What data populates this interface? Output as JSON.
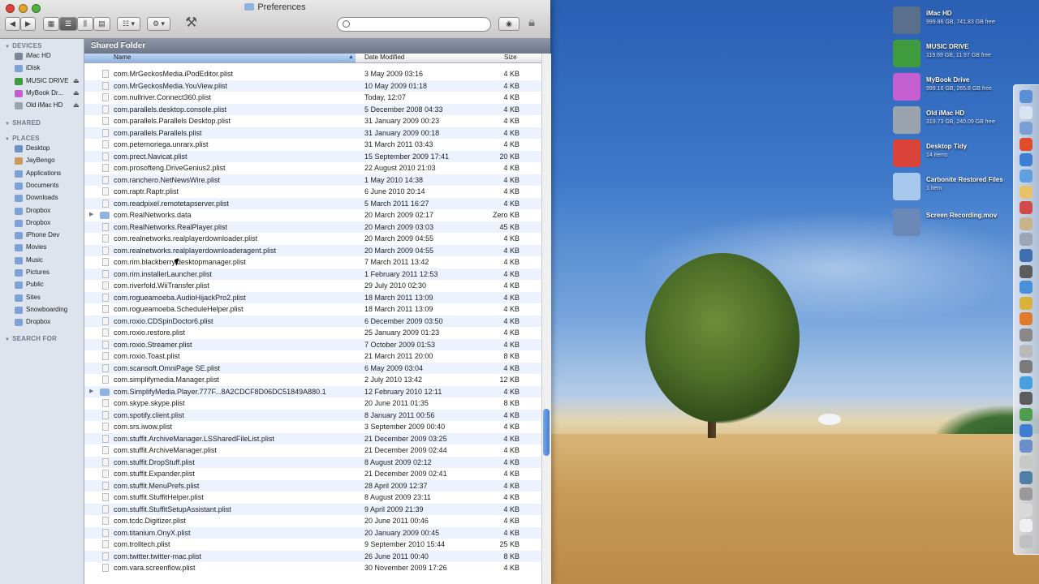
{
  "window": {
    "title": "Preferences",
    "path_title": "Shared Folder",
    "search_placeholder": ""
  },
  "toolbar": {
    "back": "◀",
    "forward": "▶",
    "view_icon": "view-icons-icon",
    "view_list": "view-list-icon",
    "view_columns": "view-columns-icon",
    "view_coverflow": "view-coverflow-icon",
    "arrange": "arrange-icon",
    "action": "gear-icon",
    "utility": "tools-icon",
    "quicklook": "eye-icon"
  },
  "sidebar": {
    "devices_header": "DEVICES",
    "devices": [
      {
        "label": "iMac HD",
        "eject": false,
        "color": "#7b8797"
      },
      {
        "label": "iDisk",
        "eject": false,
        "color": "#7ea1d6"
      },
      {
        "label": "MUSIC DRIVE",
        "eject": true,
        "color": "#3e9b3e"
      },
      {
        "label": "MyBook Dr...",
        "eject": true,
        "color": "#c55ed1"
      },
      {
        "label": "Old iMac HD",
        "eject": true,
        "color": "#9aa4ae"
      }
    ],
    "shared_header": "SHARED",
    "places_header": "PLACES",
    "places": [
      {
        "label": "Desktop",
        "color": "#6f8fc6"
      },
      {
        "label": "JayBengo",
        "color": "#c99b5c"
      },
      {
        "label": "Applications",
        "color": "#7ea1d6"
      },
      {
        "label": "Documents",
        "color": "#7ea1d6"
      },
      {
        "label": "Downloads",
        "color": "#7ea1d6"
      },
      {
        "label": "Dropbox",
        "color": "#7ea1d6"
      },
      {
        "label": "Dropbox",
        "color": "#7ea1d6"
      },
      {
        "label": "iPhone Dev",
        "color": "#7ea1d6"
      },
      {
        "label": "Movies",
        "color": "#7ea1d6"
      },
      {
        "label": "Music",
        "color": "#7ea1d6"
      },
      {
        "label": "Pictures",
        "color": "#7ea1d6"
      },
      {
        "label": "Public",
        "color": "#7ea1d6"
      },
      {
        "label": "Sites",
        "color": "#7ea1d6"
      },
      {
        "label": "Snowboarding",
        "color": "#7ea1d6"
      },
      {
        "label": "Dropbox",
        "color": "#7ea1d6"
      }
    ],
    "search_header": "SEARCH FOR"
  },
  "columns": {
    "name": "Name",
    "date": "Date Modified",
    "size": "Size"
  },
  "files": [
    {
      "name": "com.MrGeckosMedia.iPodEditor.plist",
      "date": "3 May 2009 03:16",
      "size": "4 KB",
      "folder": false
    },
    {
      "name": "com.MrGeckosMedia.YouView.plist",
      "date": "10 May 2009 01:18",
      "size": "4 KB",
      "folder": false
    },
    {
      "name": "com.nullriver.Connect360.plist",
      "date": "Today, 12:07",
      "size": "4 KB",
      "folder": false
    },
    {
      "name": "com.parallels.desktop.console.plist",
      "date": "5 December 2008 04:33",
      "size": "4 KB",
      "folder": false
    },
    {
      "name": "com.parallels.Parallels Desktop.plist",
      "date": "31 January 2009 00:23",
      "size": "4 KB",
      "folder": false
    },
    {
      "name": "com.parallels.Parallels.plist",
      "date": "31 January 2009 00:18",
      "size": "4 KB",
      "folder": false
    },
    {
      "name": "com.peternoriega.unrarx.plist",
      "date": "31 March 2011 03:43",
      "size": "4 KB",
      "folder": false
    },
    {
      "name": "com.prect.Navicat.plist",
      "date": "15 September 2009 17:41",
      "size": "20 KB",
      "folder": false
    },
    {
      "name": "com.prosofteng.DriveGenius2.plist",
      "date": "22 August 2010 21:03",
      "size": "4 KB",
      "folder": false
    },
    {
      "name": "com.ranchero.NetNewsWire.plist",
      "date": "1 May 2010 14:38",
      "size": "4 KB",
      "folder": false
    },
    {
      "name": "com.raptr.Raptr.plist",
      "date": "6 June 2010 20:14",
      "size": "4 KB",
      "folder": false
    },
    {
      "name": "com.readpixel.remotetapserver.plist",
      "date": "5 March 2011 16:27",
      "size": "4 KB",
      "folder": false
    },
    {
      "name": "com.RealNetworks.data",
      "date": "20 March 2009 02:17",
      "size": "Zero KB",
      "folder": true
    },
    {
      "name": "com.RealNetworks.RealPlayer.plist",
      "date": "20 March 2009 03:03",
      "size": "45 KB",
      "folder": false
    },
    {
      "name": "com.realnetworks.realplayerdownloader.plist",
      "date": "20 March 2009 04:55",
      "size": "4 KB",
      "folder": false
    },
    {
      "name": "com.realnetworks.realplayerdownloaderagent.plist",
      "date": "20 March 2009 04:55",
      "size": "4 KB",
      "folder": false
    },
    {
      "name": "com.rim.blackberry.desktopmanager.plist",
      "date": "7 March 2011 13:42",
      "size": "4 KB",
      "folder": false
    },
    {
      "name": "com.rim.installerLauncher.plist",
      "date": "1 February 2011 12:53",
      "size": "4 KB",
      "folder": false
    },
    {
      "name": "com.riverfold.WiiTransfer.plist",
      "date": "29 July 2010 02:30",
      "size": "4 KB",
      "folder": false
    },
    {
      "name": "com.rogueamoeba.AudioHijackPro2.plist",
      "date": "18 March 2011 13:09",
      "size": "4 KB",
      "folder": false
    },
    {
      "name": "com.rogueamoeba.ScheduleHelper.plist",
      "date": "18 March 2011 13:09",
      "size": "4 KB",
      "folder": false
    },
    {
      "name": "com.roxio.CDSpinDoctor6.plist",
      "date": "6 December 2009 03:50",
      "size": "4 KB",
      "folder": false
    },
    {
      "name": "com.roxio.restore.plist",
      "date": "25 January 2009 01:23",
      "size": "4 KB",
      "folder": false
    },
    {
      "name": "com.roxio.Streamer.plist",
      "date": "7 October 2009 01:53",
      "size": "4 KB",
      "folder": false
    },
    {
      "name": "com.roxio.Toast.plist",
      "date": "21 March 2011 20:00",
      "size": "8 KB",
      "folder": false
    },
    {
      "name": "com.scansoft.OmniPage SE.plist",
      "date": "6 May 2009 03:04",
      "size": "4 KB",
      "folder": false
    },
    {
      "name": "com.simplifymedia.Manager.plist",
      "date": "2 July 2010 13:42",
      "size": "12 KB",
      "folder": false
    },
    {
      "name": "com.SimplifyMedia.Player.777F...8A2CDCF8D06DC51849A880.1",
      "date": "12 February 2010 12:11",
      "size": "4 KB",
      "folder": true
    },
    {
      "name": "com.skype.skype.plist",
      "date": "20 June 2011 01:35",
      "size": "8 KB",
      "folder": false
    },
    {
      "name": "com.spotify.client.plist",
      "date": "8 January 2011 00:56",
      "size": "4 KB",
      "folder": false
    },
    {
      "name": "com.srs.iwow.plist",
      "date": "3 September 2009 00:40",
      "size": "4 KB",
      "folder": false
    },
    {
      "name": "com.stuffit.ArchiveManager.LSSharedFileList.plist",
      "date": "21 December 2009 03:25",
      "size": "4 KB",
      "folder": false
    },
    {
      "name": "com.stuffit.ArchiveManager.plist",
      "date": "21 December 2009 02:44",
      "size": "4 KB",
      "folder": false
    },
    {
      "name": "com.stuffit.DropStuff.plist",
      "date": "8 August 2009 02:12",
      "size": "4 KB",
      "folder": false
    },
    {
      "name": "com.stuffit.Expander.plist",
      "date": "21 December 2009 02:41",
      "size": "4 KB",
      "folder": false
    },
    {
      "name": "com.stuffit.MenuPrefs.plist",
      "date": "28 April 2009 12:37",
      "size": "4 KB",
      "folder": false
    },
    {
      "name": "com.stuffit.StuffitHelper.plist",
      "date": "8 August 2009 23:11",
      "size": "4 KB",
      "folder": false
    },
    {
      "name": "com.stuffit.StuffitSetupAssistant.plist",
      "date": "9 April 2009 21:39",
      "size": "4 KB",
      "folder": false
    },
    {
      "name": "com.tcdc.Digitizer.plist",
      "date": "20 June 2011 00:46",
      "size": "4 KB",
      "folder": false
    },
    {
      "name": "com.titanium.OnyX.plist",
      "date": "20 January 2009 00:45",
      "size": "4 KB",
      "folder": false
    },
    {
      "name": "com.trolltech.plist",
      "date": "9 September 2010 15:44",
      "size": "25 KB",
      "folder": false
    },
    {
      "name": "com.twitter.twitter-mac.plist",
      "date": "26 June 2011 00:40",
      "size": "8 KB",
      "folder": false
    },
    {
      "name": "com.vara.screenflow.plist",
      "date": "30 November 2009 17:26",
      "size": "4 KB",
      "folder": false
    }
  ],
  "desktop_items": [
    {
      "name": "iMac HD",
      "sub": "999.86 GB, 741.83 GB free",
      "icon": "imac-hd-icon",
      "color": "#5a6f8c"
    },
    {
      "name": "MUSIC DRIVE",
      "sub": "119.69 GB, 11.97 GB free",
      "icon": "music-drive-icon",
      "color": "#3e9b3e"
    },
    {
      "name": "MyBook Drive",
      "sub": "999.16 GB, 265.8 GB free",
      "icon": "mybook-drive-icon",
      "color": "#c55ed1"
    },
    {
      "name": "Old iMac HD",
      "sub": "319.73 GB, 240.09 GB free",
      "icon": "old-imac-hd-icon",
      "color": "#9aa4ae"
    },
    {
      "name": "Desktop Tidy",
      "sub": "14 items",
      "icon": "desktop-tidy-icon",
      "color": "#d9433a"
    },
    {
      "name": "Carbonite Restored Files",
      "sub": "1 item",
      "icon": "folder-icon",
      "color": "#a8c8ee"
    },
    {
      "name": "Screen Recording.mov",
      "sub": "",
      "icon": "movie-file-icon",
      "color": "#6a88b8"
    }
  ],
  "dock_colors": [
    "#5b8fd6",
    "#d8e2f0",
    "#7a9fd4",
    "#e04b2a",
    "#3a7fd5",
    "#5fa0e0",
    "#e6c36a",
    "#d24a4a",
    "#c8b48c",
    "#9ca6b5",
    "#3f6fb0",
    "#5c5c5c",
    "#4a8fd8",
    "#d9b13c",
    "#e07a2a",
    "#888",
    "#b9b9b9",
    "#7a7a7a",
    "#46a0e0",
    "#5c5c5c",
    "#4f9e4f",
    "#3d7ed0",
    "#6a8fc9",
    "#c8c8c8",
    "#4f7fa6",
    "#9a9a9a",
    "#d9d9d9",
    "#f0f0f0",
    "#c0c0c0"
  ]
}
